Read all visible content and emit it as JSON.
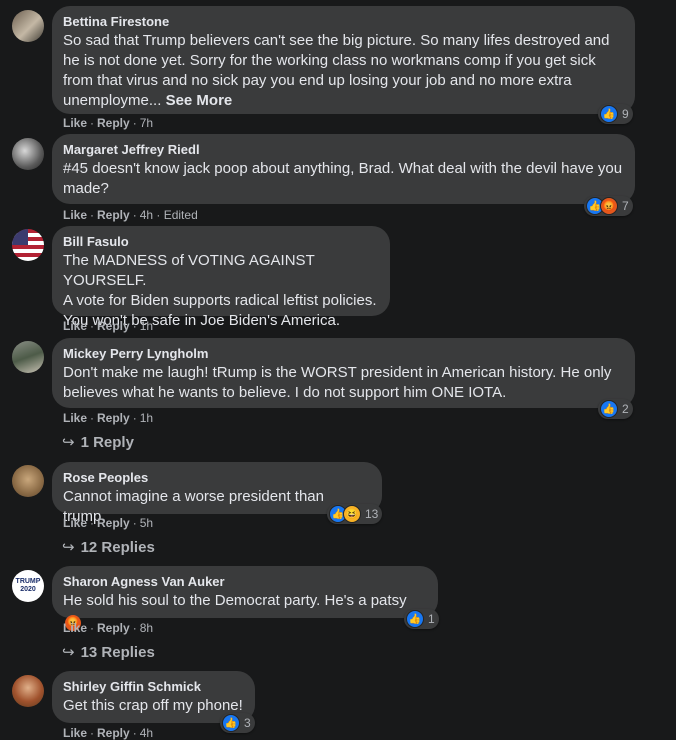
{
  "comments": [
    {
      "author": "Bettina Firestone",
      "text": "So sad that Trump believers can't see the big picture. So many lifes destroyed and he is not done yet. Sorry for the working class no workmans comp if you get sick from that virus and no sick pay you end up losing your job and no more extra unemployme...",
      "see_more": "See More",
      "time": "7h",
      "reaction_count": "9"
    },
    {
      "author": "Margaret Jeffrey Riedl",
      "text": "#45 doesn't know jack poop about anything, Brad. What deal with the devil have you made?",
      "time": "4h · Edited",
      "reaction_count": "7"
    },
    {
      "author": "Bill Fasulo",
      "text": "The MADNESS of VOTING AGAINST YOURSELF.\nA vote for Biden supports radical leftist policies.\nYou won't be safe in Joe Biden's America.",
      "time": "1h"
    },
    {
      "author": "Mickey Perry Lyngholm",
      "text": "Don't make me laugh! tRump is the WORST president in American history. He only believes what he wants to believe. I do not support him ONE IOTA.",
      "time": "1h",
      "reaction_count": "2",
      "replies": "1 Reply"
    },
    {
      "author": "Rose Peoples",
      "text": "Cannot imagine a worse president than trump.",
      "time": "5h",
      "reaction_count": "13",
      "replies": "12 Replies"
    },
    {
      "author": "Sharon Agness Van Auker",
      "text": "He sold his soul to the Democrat party. He's a patsy",
      "time": "8h",
      "reaction_count": "1",
      "replies": "13 Replies",
      "avatar_text": "TRUMP 2020"
    },
    {
      "author": "Shirley Giffin Schmick",
      "text": "Get this crap off my phone!",
      "time": "4h",
      "reaction_count": "3"
    }
  ],
  "actions": {
    "like": "Like",
    "reply": "Reply",
    "separator": "·"
  },
  "colors": {
    "background": "#18191a",
    "bubble": "#3a3b3c",
    "like": "#1877f2",
    "angry": "#e4571c",
    "haha": "#f7b125",
    "muted": "#b0b3b8"
  },
  "icons": [
    "like-reaction-icon",
    "angry-reaction-icon",
    "haha-reaction-icon",
    "reply-arrow-icon"
  ]
}
